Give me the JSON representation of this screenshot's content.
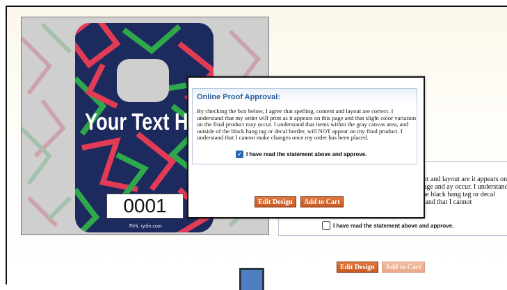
{
  "hangtag": {
    "text": "Your Text He",
    "number": "0001",
    "footer_url": "FiHi. rydin.com"
  },
  "modal": {
    "title": "Online Proof Approval:",
    "statement": "By checking the box below, I agree that spelling, content and layout are correct. I understand that my order will print as it appears on this page and that slight color variation on the final product may occur. I understand that items within the gray canvas area, and outside of the black hang tag or decal border, will NOT appear on my final product. I understand that I cannot make changes once my order has been placed.",
    "checkbox_label": "I have read the statement above and approve.",
    "checked": true,
    "edit_label": "Edit Design",
    "cart_label": "Add to Cart"
  },
  "background_panel": {
    "partial_text": "content and layout are it appears on this page and ay occur. I understand that the black hang tag or decal nderstand that I cannot",
    "checkbox_label": "I have read the statement above and approve.",
    "checked": false
  },
  "background_buttons": {
    "edit_label": "Edit Design",
    "cart_label": "Add to Cart"
  },
  "colors": {
    "accent": "#2c5e9c",
    "button": "#d4662d",
    "tag_navy": "#1c2a5e",
    "tag_red": "#e23b55",
    "tag_green": "#2fa84b"
  }
}
